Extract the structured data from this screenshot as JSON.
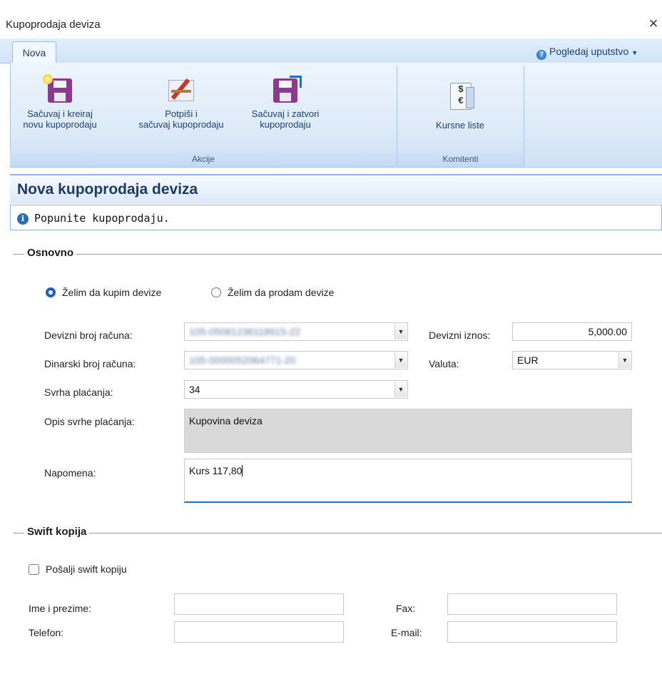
{
  "window": {
    "title": "Kupoprodaja deviza",
    "close_glyph": "×"
  },
  "ribbon": {
    "tab": "Nova",
    "help_label": "Pogledaj uputstvo",
    "groups": {
      "akcije": {
        "label": "Akcije",
        "buttons": [
          {
            "line1": "Sačuvaj i kreiraj",
            "line2": "novu kupoprodaju",
            "icon": "save-new-icon"
          },
          {
            "line1": "Potpiši i",
            "line2": "sačuvaj kupoprodaju",
            "icon": "sign-save-icon"
          },
          {
            "line1": "Sačuvaj i zatvori",
            "line2": "kupoprodaju",
            "icon": "save-close-icon"
          }
        ]
      },
      "komitenti": {
        "label": "Komitenti",
        "buttons": [
          {
            "line1": "Kursne liste",
            "icon": "exchange-rate-list-icon"
          }
        ]
      }
    }
  },
  "form": {
    "title": "Nova kupoprodaja deviza",
    "info": "Popunite kupoprodaju.",
    "osnovno": {
      "section_title": "Osnovno",
      "radio_buy": "Želim da kupim devize",
      "radio_sell": "Želim da prodam devize",
      "devizni_label": "Devizni broj računa:",
      "devizni_value": "105-05081236118915-22",
      "dinarski_label": "Dinarski broj računa:",
      "dinarski_value": "105-0000052064771-20",
      "svrha_label": "Svrha plaćanja:",
      "svrha_value": "34",
      "opis_label": "Opis svrhe plaćanja:",
      "opis_value": "Kupovina deviza",
      "napomena_label": "Napomena:",
      "napomena_value": "Kurs 117,80",
      "iznos_label": "Devizni iznos:",
      "iznos_value": "5,000.00",
      "valuta_label": "Valuta:",
      "valuta_value": "EUR"
    },
    "swift": {
      "section_title": "Swift kopija",
      "checkbox_label": "Pošalji swift kopiju",
      "ime_label": "Ime i prezime:",
      "telefon_label": "Telefon:",
      "fax_label": "Fax:",
      "email_label": "E-mail:"
    }
  },
  "colors": {
    "accent": "#1f5fc0",
    "ribbon": "#dbe9f8",
    "title_text": "#1e3a66"
  }
}
